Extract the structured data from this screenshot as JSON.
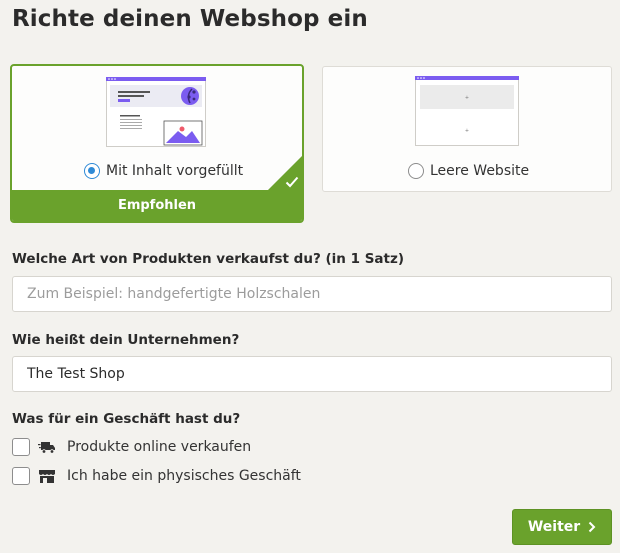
{
  "page_title": "Richte deinen Webshop ein",
  "options": {
    "filled": {
      "label": "Mit Inhalt vorgefüllt",
      "badge": "Empfohlen",
      "selected": true
    },
    "empty": {
      "label": "Leere Website",
      "selected": false
    }
  },
  "products_question": {
    "label": "Welche Art von Produkten verkaufst du? (in 1 Satz)",
    "placeholder": "Zum Beispiel: handgefertigte Holzschalen",
    "value": ""
  },
  "company_question": {
    "label": "Wie heißt dein Unternehmen?",
    "value": "The Test Shop"
  },
  "business_type": {
    "label": "Was für ein Geschäft hast du?",
    "options": [
      {
        "label": "Produkte online verkaufen",
        "icon": "truck-icon",
        "checked": false
      },
      {
        "label": "Ich habe ein physisches Geschäft",
        "icon": "store-icon",
        "checked": false
      }
    ]
  },
  "next_button": {
    "label": "Weiter",
    "icon": "chevron-right-icon"
  },
  "colors": {
    "accent_green": "#6aa22c",
    "radio_blue": "#2f8ad6",
    "preview_purple": "#7b5cf0"
  }
}
